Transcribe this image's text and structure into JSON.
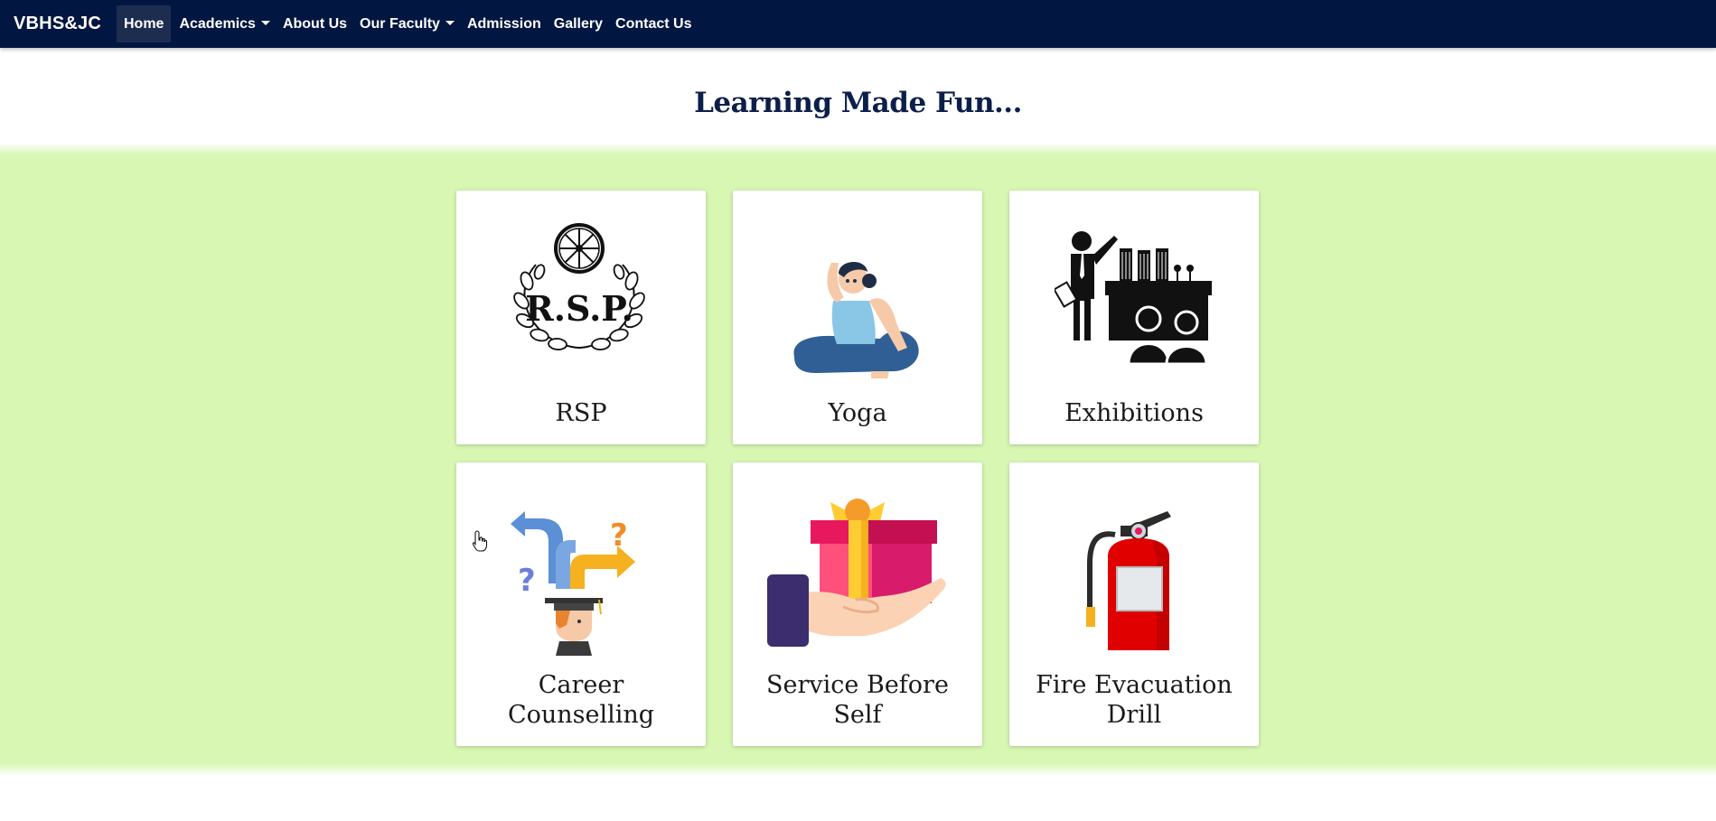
{
  "navbar": {
    "brand": "VBHS&JC",
    "items": [
      {
        "label": "Home",
        "active": true,
        "dropdown": false
      },
      {
        "label": "Academics",
        "active": false,
        "dropdown": true
      },
      {
        "label": "About Us",
        "active": false,
        "dropdown": false
      },
      {
        "label": "Our Faculty",
        "active": false,
        "dropdown": true
      },
      {
        "label": "Admission",
        "active": false,
        "dropdown": false
      },
      {
        "label": "Gallery",
        "active": false,
        "dropdown": false
      },
      {
        "label": "Contact Us",
        "active": false,
        "dropdown": false
      }
    ]
  },
  "main": {
    "heading": "Learning Made Fun..."
  },
  "cards": [
    {
      "title": "RSP",
      "icon": "rsp-emblem-icon",
      "logo_text": "R.S.P."
    },
    {
      "title": "Yoga",
      "icon": "yoga-pose-icon"
    },
    {
      "title": "Exhibitions",
      "icon": "exhibition-presenter-icon"
    },
    {
      "title": "Career Counselling",
      "title_line1": "Career",
      "title_line2": "Counselling",
      "icon": "career-crossroads-icon"
    },
    {
      "title": "Service Before Self",
      "title_line1": "Service Before",
      "title_line2": "Self",
      "icon": "gift-in-hand-icon"
    },
    {
      "title": "Fire Evacuation Drill",
      "title_line1": "Fire Evacuation",
      "title_line2": "Drill",
      "icon": "fire-extinguisher-icon"
    }
  ],
  "colors": {
    "navbar_bg": "#011640",
    "band_bg": "#d7f7b3",
    "heading": "#0c1f4a"
  }
}
